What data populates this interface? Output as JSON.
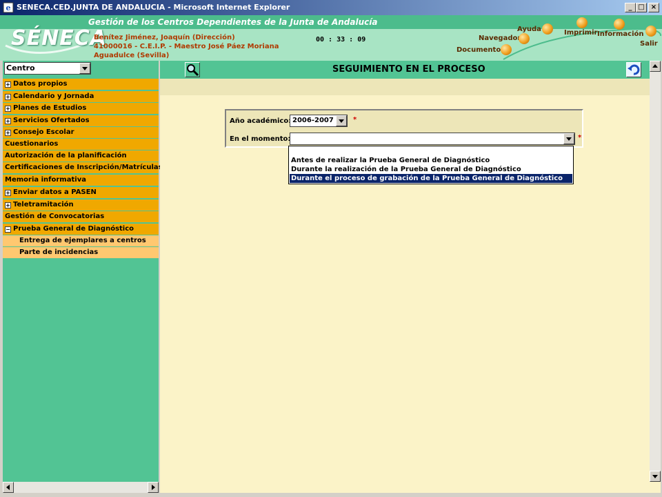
{
  "window": {
    "title": "SENECA.CED.JUNTA DE ANDALUCIA - Microsoft Internet Explorer",
    "minimize": "_",
    "maximize": "□",
    "close": "×"
  },
  "header": {
    "logo_text": "SÉNECA",
    "subtitle": "Gestión de los Centros Dependientes de  la Junta de Andalucía",
    "user_line1": "Benítez Jiménez, Joaquín (Dirección)",
    "user_line2": "41000016 - C.E.I.P. - Maestro José Páez Moriana",
    "user_line3": "Aguadulce (Sevilla)",
    "clock": "00 : 33 : 09",
    "nav": {
      "ayuda": "Ayuda",
      "imprimir": "Imprimir",
      "informacion": "Información",
      "navegador": "Navegador",
      "salir": "Salir",
      "documentos": "Documentos"
    }
  },
  "sidebar": {
    "centro_value": "Centro",
    "items": [
      {
        "label": "Datos propios",
        "expander": "+"
      },
      {
        "label": "Calendario y Jornada",
        "expander": "+"
      },
      {
        "label": "Planes de Estudios",
        "expander": "+"
      },
      {
        "label": "Servicios Ofertados",
        "expander": "+"
      },
      {
        "label": "Consejo Escolar",
        "expander": "+"
      },
      {
        "label": "Cuestionarios"
      },
      {
        "label": "Autorización de la planificación"
      },
      {
        "label": "Certificaciones de Inscripción/Matrículas"
      },
      {
        "label": "Memoria informativa"
      },
      {
        "label": "Enviar datos a PASEN",
        "expander": "+"
      },
      {
        "label": "Teletramitación",
        "expander": "+"
      },
      {
        "label": "Gestión de Convocatorias"
      },
      {
        "label": "Prueba General de Diagnóstico",
        "expander": "−"
      }
    ],
    "sub_items": [
      {
        "label": "Entrega de ejemplares a centros"
      },
      {
        "label": "Parte de incidencias"
      }
    ]
  },
  "main": {
    "title": "SEGUIMIENTO EN EL PROCESO",
    "form": {
      "anio_label": "Año académico:",
      "anio_value": "2006-2007",
      "momento_label": "En el momento:",
      "momento_value": "",
      "required_mark": "*"
    },
    "dropdown_options": [
      {
        "label": "Antes de realizar la Prueba General de Diagnóstico",
        "selected": false
      },
      {
        "label": "Durante la realización de la Prueba General de Diagnóstico",
        "selected": false
      },
      {
        "label": "Durante el proceso de grabación de la Prueba General de Diagnóstico",
        "selected": true
      }
    ]
  },
  "colors": {
    "green": "#52c494",
    "orange": "#f0a800",
    "light_orange": "#ffc870",
    "cream": "#fbf3c8",
    "selected": "#0a246a"
  }
}
